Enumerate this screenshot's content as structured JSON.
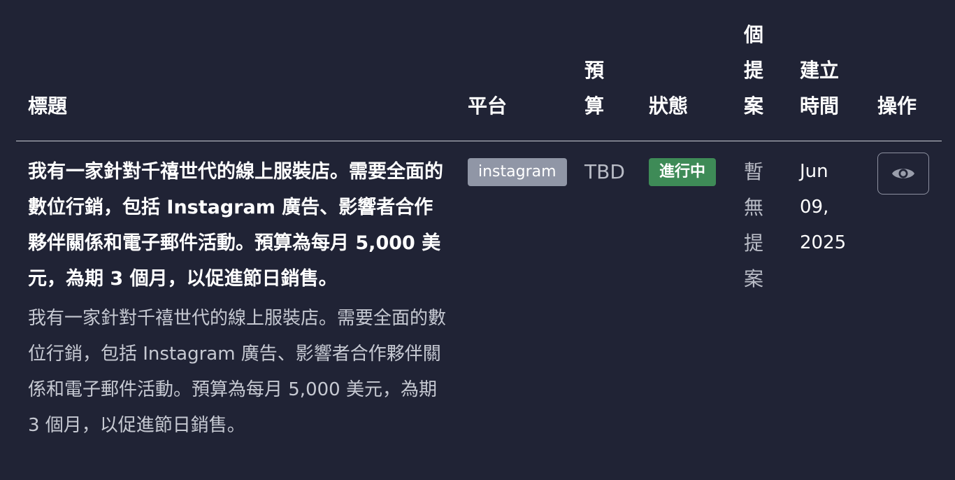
{
  "table": {
    "headers": {
      "title": "標題",
      "platform": "平台",
      "budget": "預算",
      "status": "狀態",
      "proposals": "個提案",
      "created": "建立時間",
      "actions": "操作"
    },
    "rows": [
      {
        "title": "我有一家針對千禧世代的線上服裝店。需要全面的數位行銷，包括 Instagram 廣告、影響者合作夥伴關係和電子郵件活動。預算為每月 5,000 美元，為期 3 個月，以促進節日銷售。",
        "description": "我有一家針對千禧世代的線上服裝店。需要全面的數位行銷，包括 Instagram 廣告、影響者合作夥伴關係和電子郵件活動。預算為每月 5,000 美元，為期 3 個月，以促進節日銷售。",
        "platform": "instagram",
        "budget": "TBD",
        "status": "進行中",
        "proposals": "暫無提案",
        "created": "Jun 09, 2025",
        "action_icon": "eye-icon"
      }
    ]
  },
  "colors": {
    "background": "#202335",
    "platform_badge": "#9096a6",
    "status_badge": "#3e8b57",
    "muted_text": "#c6c9d2"
  }
}
